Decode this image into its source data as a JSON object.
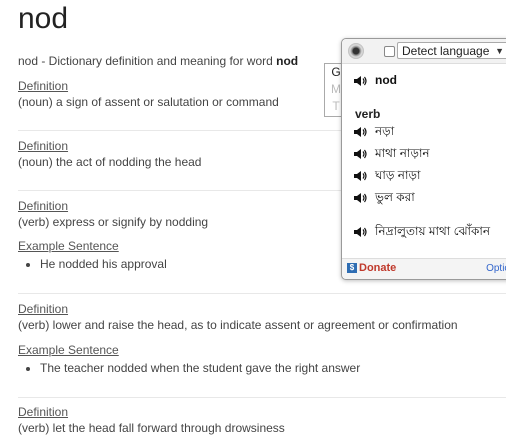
{
  "page": {
    "title": "nod",
    "subtitle_prefix": "nod - Dictionary definition and meaning for word ",
    "subtitle_word": "nod"
  },
  "entries": [
    {
      "def_label": "Definition",
      "text": "(noun) a sign of assent or salutation or command"
    },
    {
      "def_label": "Definition",
      "text": "(noun) the act of nodding the head"
    },
    {
      "def_label": "Definition",
      "text": "(verb) express or signify by nodding",
      "example_label": "Example Sentence",
      "example": "He nodded his approval"
    },
    {
      "def_label": "Definition",
      "text": "(verb) lower and raise the head, as to indicate assent or agreement or confirmation",
      "example_label": "Example Sentence",
      "example": "The teacher nodded when the student gave the right answer"
    },
    {
      "def_label": "Definition",
      "text": "(verb) let the head fall forward through drowsiness"
    }
  ],
  "popup": {
    "language_select": "Detect language",
    "tabs": [
      "G",
      "M",
      "T"
    ],
    "word": "nod",
    "part_of_speech": "verb",
    "translations": [
      "নড়া",
      "মাথা নাড়ান",
      "ঘাড় নাড়া",
      "ভুল করা",
      "নিদ্রালুতায় মাথা ঝোঁকান"
    ],
    "donate_label": "Donate",
    "options_label": "Optio"
  }
}
